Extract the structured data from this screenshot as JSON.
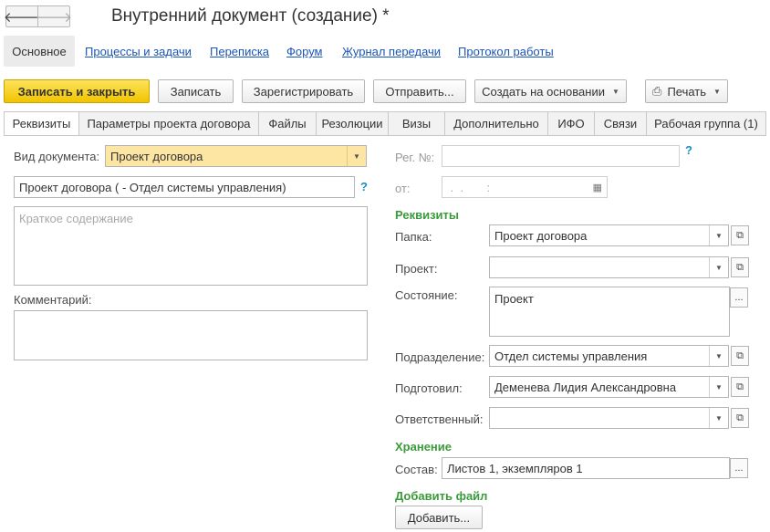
{
  "window": {
    "title": "Внутренний документ (создание) *"
  },
  "nav": {
    "sections": [
      "Основное",
      "Процессы и задачи",
      "Переписка",
      "Форум",
      "Журнал передачи",
      "Протокол работы"
    ]
  },
  "toolbar": {
    "save_close": "Записать и закрыть",
    "save": "Записать",
    "register": "Зарегистрировать",
    "send": "Отправить...",
    "create_based": "Создать на основании",
    "print": "Печать"
  },
  "tabs": [
    "Реквизиты",
    "Параметры проекта договора",
    "Файлы",
    "Резолюции",
    "Визы",
    "Дополнительно",
    "ИФО",
    "Связи",
    "Рабочая группа (1)"
  ],
  "form": {
    "doc_type_label": "Вид документа:",
    "doc_type_value": "Проект договора",
    "doc_name_value": "Проект договора ( - Отдел системы управления)",
    "summary_placeholder": "Краткое содержание",
    "comment_label": "Комментарий:",
    "reg_no_label": "Рег. №:",
    "from_label": "от:",
    "date_mask": " .  .       :  ",
    "requisites_title": "Реквизиты",
    "folder_label": "Папка:",
    "folder_value": "Проект договора",
    "project_label": "Проект:",
    "project_value": "",
    "state_label": "Состояние:",
    "state_value": "Проект",
    "department_label": "Подразделение:",
    "department_value": "Отдел системы управления",
    "prepared_label": "Подготовил:",
    "prepared_value": "Деменева Лидия Александровна",
    "responsible_label": "Ответственный:",
    "responsible_value": "",
    "storage_title": "Хранение",
    "composition_label": "Состав:",
    "composition_value": "Листов 1, экземпляров 1",
    "add_file_title": "Добавить файл",
    "add_button": "Добавить..."
  },
  "icons": {
    "back": "arrow-left-icon",
    "forward": "arrow-right-icon",
    "print": "printer-icon",
    "help": "question-icon",
    "calendar": "calendar-icon",
    "open": "open-window-icon",
    "dropdown": "chevron-down-icon"
  }
}
